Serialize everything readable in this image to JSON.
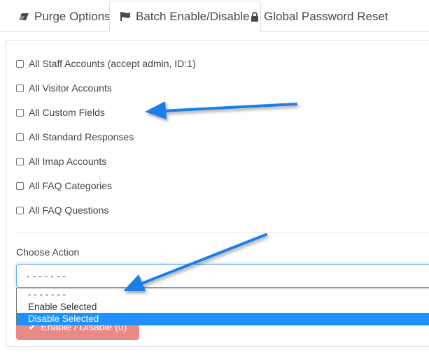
{
  "tabs": [
    {
      "label": "Purge Options",
      "icon": "eraser-icon",
      "has_caret": true
    },
    {
      "label": "Batch Enable/Disable",
      "icon": "flag-icon",
      "active": true
    },
    {
      "label": "Global Password Reset",
      "icon": "lock-icon"
    }
  ],
  "checkboxes": [
    {
      "label": "All Staff Accounts (accept admin, ID:1)",
      "checked": false
    },
    {
      "label": "All Visitor Accounts",
      "checked": false
    },
    {
      "label": "All Custom Fields",
      "checked": false
    },
    {
      "label": "All Standard Responses",
      "checked": false
    },
    {
      "label": "All Imap Accounts",
      "checked": false
    },
    {
      "label": "All FAQ Categories",
      "checked": false
    },
    {
      "label": "All FAQ Questions",
      "checked": false
    }
  ],
  "action": {
    "label": "Choose Action",
    "selected": "- - - - - - -",
    "options": [
      "- - - - - - -",
      "Enable Selected",
      "Disable Selected"
    ],
    "highlighted_option": "Disable Selected"
  },
  "submit": {
    "label": "Enable / Disable (0)",
    "icon": "check-icon"
  },
  "colors": {
    "accent": "#1e90ff",
    "danger": "#e98a86",
    "arrow": "#1a7fe8"
  }
}
